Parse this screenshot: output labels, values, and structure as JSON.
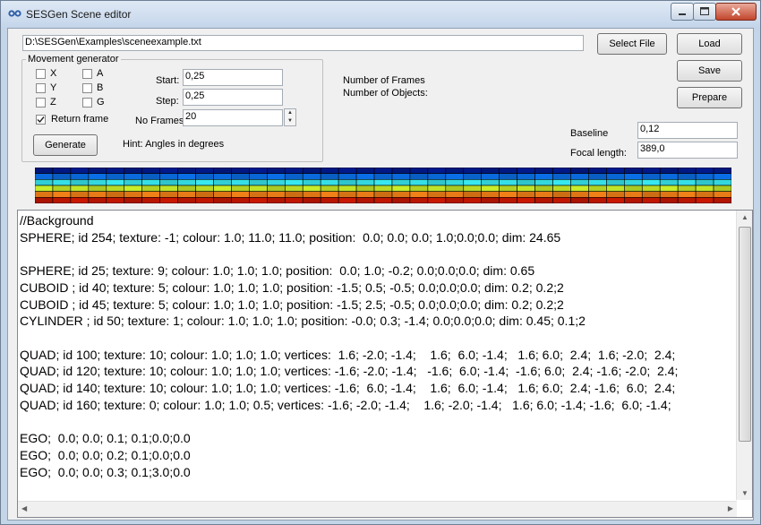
{
  "window": {
    "title": "SESGen Scene editor",
    "caption_buttons": [
      "minimize",
      "maximize",
      "close"
    ]
  },
  "file": {
    "path": "D:\\SESGen\\Examples\\sceneexample.txt",
    "select_label": "Select File"
  },
  "actions": {
    "load_label": "Load",
    "save_label": "Save",
    "prepare_label": "Prepare"
  },
  "movement": {
    "legend": "Movement generator",
    "checkboxes": [
      {
        "label": "X",
        "checked": false
      },
      {
        "label": "A",
        "checked": false
      },
      {
        "label": "Y",
        "checked": false
      },
      {
        "label": "B",
        "checked": false
      },
      {
        "label": "Z",
        "checked": false
      },
      {
        "label": "G",
        "checked": false
      }
    ],
    "return_frame": {
      "label": "Return frame",
      "checked": true
    },
    "start_label": "Start:",
    "start_value": "0,25",
    "step_label": "Step:",
    "step_value": "0,25",
    "frames_label": "No Frames:",
    "frames_value": "20",
    "generate_label": "Generate",
    "hint": "Hint: Angles in degrees"
  },
  "info": {
    "frames_label": "Number of Frames",
    "objects_label": "Number of Objects:"
  },
  "camera": {
    "baseline_label": "Baseline",
    "baseline_value": "0,12",
    "focal_label": "Focal length:",
    "focal_value": "389,0"
  },
  "palette": {
    "columns": 39,
    "row_colors": [
      "#001a8c",
      "#0a6ee6",
      "#38e8f0",
      "#c8ec2a",
      "#f08018",
      "#c81800"
    ]
  },
  "editor": {
    "lines": [
      "//Background",
      "SPHERE; id 254; texture: -1; colour: 1.0; 11.0; 11.0; position:  0.0; 0.0; 0.0; 1.0;0.0;0.0; dim: 24.65",
      "",
      "SPHERE; id 25; texture: 9; colour: 1.0; 1.0; 1.0; position:  0.0; 1.0; -0.2; 0.0;0.0;0.0; dim: 0.65",
      "CUBOID ; id 40; texture: 5; colour: 1.0; 1.0; 1.0; position: -1.5; 0.5; -0.5; 0.0;0.0;0.0; dim: 0.2; 0.2;2",
      "CUBOID ; id 45; texture: 5; colour: 1.0; 1.0; 1.0; position: -1.5; 2.5; -0.5; 0.0;0.0;0.0; dim: 0.2; 0.2;2",
      "CYLINDER ; id 50; texture: 1; colour: 1.0; 1.0; 1.0; position: -0.0; 0.3; -1.4; 0.0;0.0;0.0; dim: 0.45; 0.1;2",
      "",
      "QUAD; id 100; texture: 10; colour: 1.0; 1.0; 1.0; vertices:  1.6; -2.0; -1.4;    1.6;  6.0; -1.4;   1.6; 6.0;  2.4;  1.6; -2.0;  2.4;",
      "QUAD; id 120; texture: 10; colour: 1.0; 1.0; 1.0; vertices: -1.6; -2.0; -1.4;   -1.6;  6.0; -1.4;  -1.6; 6.0;  2.4; -1.6; -2.0;  2.4;",
      "QUAD; id 140; texture: 10; colour: 1.0; 1.0; 1.0; vertices: -1.6;  6.0; -1.4;    1.6;  6.0; -1.4;   1.6; 6.0;  2.4; -1.6;  6.0;  2.4;",
      "QUAD; id 160; texture: 0; colour: 1.0; 1.0; 0.5; vertices: -1.6; -2.0; -1.4;    1.6; -2.0; -1.4;   1.6; 6.0; -1.4; -1.6;  6.0; -1.4;",
      "",
      "EGO;  0.0; 0.0; 0.1; 0.1;0.0;0.0",
      "EGO;  0.0; 0.0; 0.2; 0.1;0.0;0.0",
      "EGO;  0.0; 0.0; 0.3; 0.1;3.0;0.0"
    ]
  }
}
